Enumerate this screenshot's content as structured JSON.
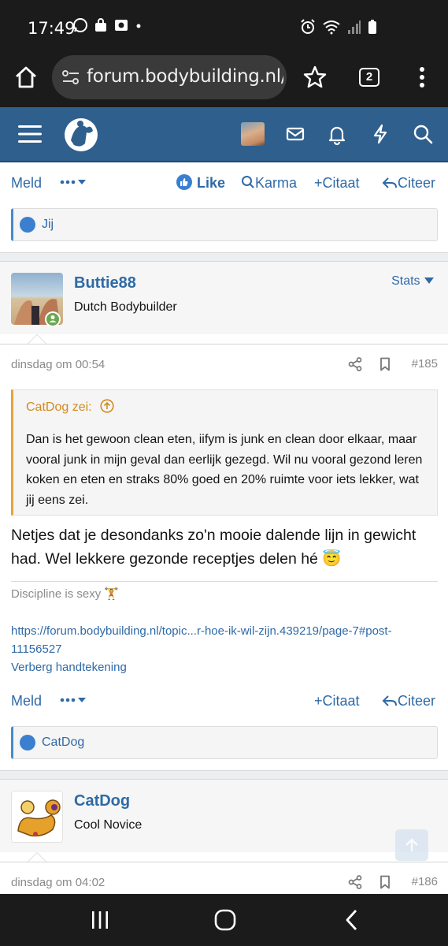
{
  "status_bar": {
    "time": "17:49"
  },
  "browser": {
    "url": "forum.bodybuilding.nl/",
    "tab_count": "2"
  },
  "post_prev": {
    "actions": {
      "report": "Meld",
      "like": "Like",
      "karma": "Karma",
      "quote": "Citaat",
      "reply": "Citeer"
    },
    "reactions": {
      "who": "Jij"
    }
  },
  "post_185": {
    "user": {
      "name": "Buttie88",
      "title": "Dutch Bodybuilder",
      "stats_label": "Stats"
    },
    "date": "dinsdag om 00:54",
    "number": "#185",
    "quote": {
      "header": "CatDog zei:",
      "body": "Dan is het gewoon clean eten, iifym is junk en clean door elkaar, maar vooral junk in mijn geval dan eerlijk gezegd. Wil nu vooral gezond leren koken en eten en straks 80% goed en 20% ruimte voor iets lekker, wat jij eens zei."
    },
    "message": "Netjes dat je desondanks zo'n mooie dalende lijn in gewicht had. Wel lekkere gezonde receptjes delen hé 😇",
    "signature": {
      "text": "Discipline is sexy 🏋️",
      "link": "https://forum.bodybuilding.nl/topic...r-hoe-ik-wil-zijn.439219/page-7#post-11156527",
      "hide": "Verberg handtekening"
    },
    "actions": {
      "report": "Meld",
      "quote": "Citaat",
      "reply": "Citeer"
    },
    "reactions": {
      "who": "CatDog"
    }
  },
  "post_186": {
    "user": {
      "name": "CatDog",
      "title": "Cool Novice"
    },
    "date": "dinsdag om 04:02",
    "number": "#186"
  },
  "colors": {
    "forum_header": "#2f5f8d",
    "link": "#2f6aa6",
    "quote_accent": "#e5a33e",
    "reaction_accent": "#4a8ac9"
  }
}
